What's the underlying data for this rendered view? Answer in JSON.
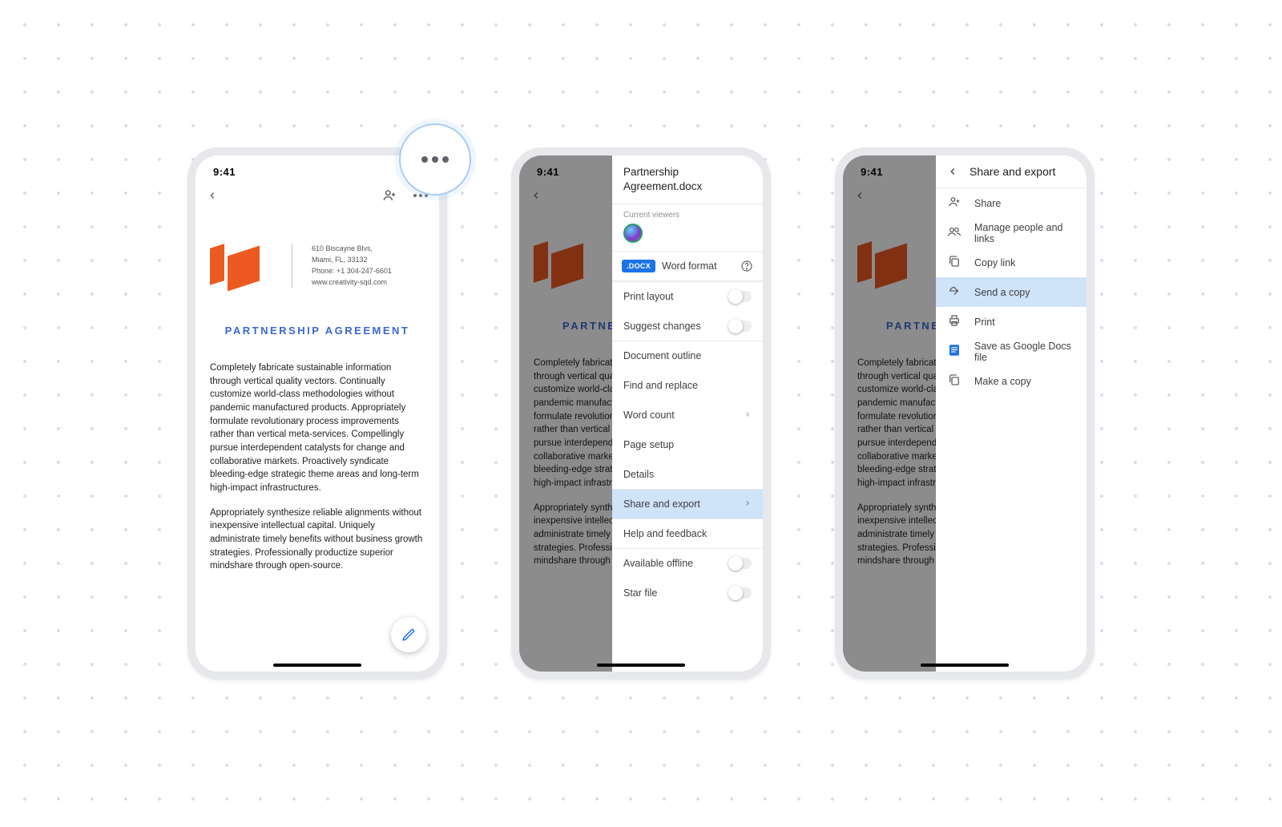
{
  "status_time": "9:41",
  "doc": {
    "title": "PARTNERSHIP AGREEMENT",
    "addr_l1": "610 Biscayne Blvs,",
    "addr_l2": "Miami, FL, 33132",
    "addr_l3": "Phone: +1 304-247-6601",
    "addr_l4": "www.creativity-sqd.com",
    "p1": "Completely fabricate sustainable information through vertical quality vectors. Continually customize world-class methodologies without pandemic manufactured products. Appropriately formulate revolutionary process improvements rather than vertical meta-services. Compellingly pursue interdependent catalysts for change and collaborative markets. Proactively syndicate bleeding-edge strategic theme areas and long-term high-impact infrastructures.",
    "p2": "Appropriately synthesize reliable alignments without inexpensive intellectual capital. Uniquely administrate timely benefits without business growth strategies. Professionally productize superior mindshare through open-source."
  },
  "menu": {
    "file_title": "Partnership Agreement.docx",
    "viewers_label": "Current viewers",
    "badge": ".DOCX",
    "format": "Word format",
    "items": {
      "print_layout": "Print layout",
      "suggest": "Suggest changes",
      "outline": "Document outline",
      "find": "Find and replace",
      "wordcount": "Word count",
      "pagesetup": "Page setup",
      "details": "Details",
      "share_export": "Share and export",
      "help": "Help and feedback",
      "offline": "Available offline",
      "star": "Star file"
    }
  },
  "share": {
    "title": "Share and export",
    "share": "Share",
    "manage": "Manage people and links",
    "copy": "Copy link",
    "send": "Send a copy",
    "print": "Print",
    "save": "Save as Google Docs file",
    "makecopy": "Make a copy"
  }
}
